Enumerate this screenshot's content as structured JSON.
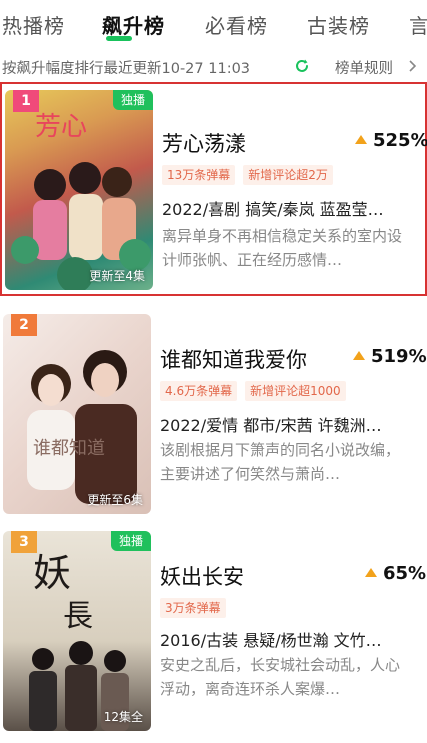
{
  "tabs": [
    {
      "label": "热播榜"
    },
    {
      "label": "飙升榜"
    },
    {
      "label": "必看榜"
    },
    {
      "label": "古装榜"
    },
    {
      "label": "言"
    }
  ],
  "subbar": {
    "text": "按飙升幅度排行最近更新10-27 11:03",
    "rules": "榜单规则"
  },
  "colors": {
    "accent": "#19c25c",
    "up_arrow": "#f2a21b",
    "highlight_border": "#d73232"
  },
  "items": [
    {
      "rank": "1",
      "rank_color": "#f04a7a",
      "exclusive": "独播",
      "episodes": "更新至4集",
      "title": "芳心荡漾",
      "trend": "525%",
      "tags": [
        "13万条弹幕",
        "新增评论超2万"
      ],
      "meta": "2022/喜剧 搞笑/秦岚 蓝盈莹…",
      "desc": "离异单身不再相信稳定关系的室内设计师张帆、正在经历感情…"
    },
    {
      "rank": "2",
      "rank_color": "#f07a3a",
      "exclusive": "",
      "episodes": "更新至6集",
      "title": "谁都知道我爱你",
      "trend": "519%",
      "tags": [
        "4.6万条弹幕",
        "新增评论超1000"
      ],
      "meta": "2022/爱情 都市/宋茜 许魏洲…",
      "desc": "该剧根据月下箫声的同名小说改编，主要讲述了何笑然与萧尚…"
    },
    {
      "rank": "3",
      "rank_color": "#f0a23a",
      "exclusive": "独播",
      "episodes": "12集全",
      "title": "妖出长安",
      "trend": "65%",
      "tags": [
        "3万条弹幕"
      ],
      "meta": "2016/古装 悬疑/杨世瀚 文竹…",
      "desc": "安史之乱后，长安城社会动乱，人心浮动，离奇连环杀人案爆…"
    }
  ]
}
